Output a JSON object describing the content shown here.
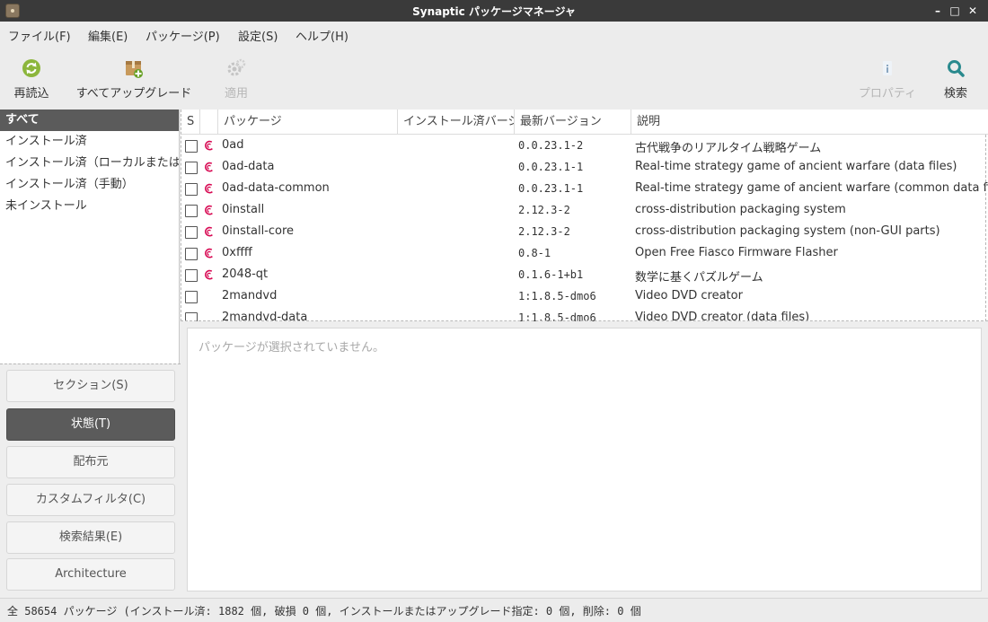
{
  "window": {
    "title": "Synaptic パッケージマネージャ",
    "minimize": "–",
    "maximize": "□",
    "close": "✕"
  },
  "menu": [
    "ファイル(F)",
    "編集(E)",
    "パッケージ(P)",
    "設定(S)",
    "ヘルプ(H)"
  ],
  "toolbar": {
    "reload": "再読込",
    "upgrade_all": "すべてアップグレード",
    "apply": "適用",
    "properties": "プロパティ",
    "search": "検索"
  },
  "filters": {
    "items": [
      "すべて",
      "インストール済",
      "インストール済（ローカルまたは古いもの）",
      "インストール済（手動）",
      "未インストール"
    ],
    "selected_index": 0
  },
  "filter_buttons": {
    "sections": "セクション(S)",
    "status": "状態(T)",
    "origin": "配布元",
    "custom": "カスタムフィルタ(C)",
    "search_results": "検索結果(E)",
    "architecture": "Architecture"
  },
  "table": {
    "columns": {
      "status": "S",
      "package": "パッケージ",
      "installed_version": "インストール済バージョン",
      "latest_version": "最新バージョン",
      "description": "説明"
    },
    "rows": [
      {
        "name": "0ad",
        "version": "0.0.23.1-2",
        "description": "古代戦争のリアルタイム戦略ゲーム",
        "debian": true
      },
      {
        "name": "0ad-data",
        "version": "0.0.23.1-1",
        "description": "Real-time strategy game of ancient warfare (data files)",
        "debian": true
      },
      {
        "name": "0ad-data-common",
        "version": "0.0.23.1-1",
        "description": "Real-time strategy game of ancient warfare (common data files)",
        "debian": true
      },
      {
        "name": "0install",
        "version": "2.12.3-2",
        "description": "cross-distribution packaging system",
        "debian": true
      },
      {
        "name": "0install-core",
        "version": "2.12.3-2",
        "description": "cross-distribution packaging system (non-GUI parts)",
        "debian": true
      },
      {
        "name": "0xffff",
        "version": "0.8-1",
        "description": "Open Free Fiasco Firmware Flasher",
        "debian": true
      },
      {
        "name": "2048-qt",
        "version": "0.1.6-1+b1",
        "description": "数学に基くパズルゲーム",
        "debian": true
      },
      {
        "name": "2mandvd",
        "version": "1:1.8.5-dmo6",
        "description": "Video DVD creator",
        "debian": false
      },
      {
        "name": "2mandvd-data",
        "version": "1:1.8.5-dmo6",
        "description": "Video DVD creator (data files)",
        "debian": false
      }
    ]
  },
  "details": {
    "placeholder": "パッケージが選択されていません。"
  },
  "statusbar": {
    "text": "全 58654 パッケージ (インストール済: 1882 個, 破損 0 個, インストールまたはアップグレード指定: 0 個, 削除: 0 個"
  },
  "colors": {
    "selection": "#5b5b5b",
    "debian_red": "#d70751",
    "reload_green": "#8cb63c",
    "search_teal": "#2a8a8e",
    "titlebar": "#3a3a3a"
  }
}
